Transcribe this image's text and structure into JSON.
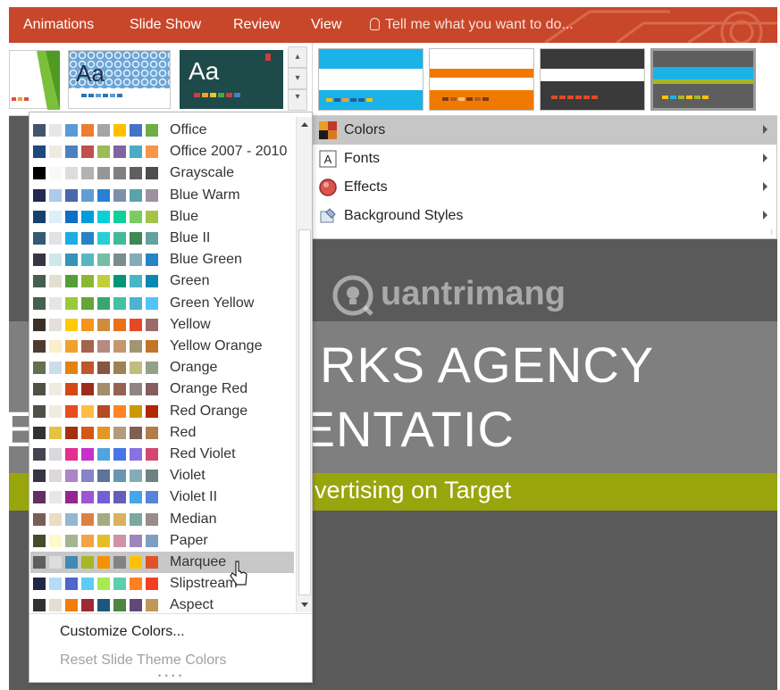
{
  "ribbon": {
    "tabs": [
      "Animations",
      "Slide Show",
      "Review",
      "View"
    ],
    "tell_me": "Tell me what you want to do..."
  },
  "themes": {
    "thumb1_text": "Aa",
    "thumb2_text": "Aa"
  },
  "design_menu": {
    "items": [
      {
        "label": "Colors",
        "icon": "colors-icon",
        "highlighted": true
      },
      {
        "label": "Fonts",
        "icon": "fonts-icon",
        "highlighted": false
      },
      {
        "label": "Effects",
        "icon": "effects-icon",
        "highlighted": false
      },
      {
        "label": "Background Styles",
        "icon": "background-styles-icon",
        "highlighted": false
      }
    ]
  },
  "colors_dropdown": {
    "schemes": [
      {
        "name": "Office",
        "colors": [
          "#44546a",
          "#e7e6e6",
          "#5b9bd5",
          "#ed7d31",
          "#a5a5a5",
          "#ffc000",
          "#4472c4",
          "#70ad47"
        ]
      },
      {
        "name": "Office 2007 - 2010",
        "colors": [
          "#1f497d",
          "#eeece1",
          "#4f81bd",
          "#c0504d",
          "#9bbb59",
          "#8064a2",
          "#4bacc6",
          "#f79646"
        ]
      },
      {
        "name": "Grayscale",
        "colors": [
          "#000000",
          "#f8f8f8",
          "#dddddd",
          "#b2b2b2",
          "#969696",
          "#808080",
          "#5f5f5f",
          "#4d4d4d"
        ]
      },
      {
        "name": "Blue Warm",
        "colors": [
          "#242852",
          "#acccea",
          "#4a66ac",
          "#629dd1",
          "#297fd5",
          "#7f8fa9",
          "#5aa2ae",
          "#9d90a0"
        ]
      },
      {
        "name": "Blue",
        "colors": [
          "#17406d",
          "#dbeff9",
          "#0f6fc6",
          "#009dd9",
          "#0bd0d9",
          "#10cf9b",
          "#7cca62",
          "#a5c249"
        ]
      },
      {
        "name": "Blue II",
        "colors": [
          "#335b74",
          "#dfe3e5",
          "#1cade4",
          "#2683c6",
          "#27ced7",
          "#42ba97",
          "#3e8853",
          "#62a39f"
        ]
      },
      {
        "name": "Blue Green",
        "colors": [
          "#373545",
          "#cee8ea",
          "#3494ba",
          "#58b6c0",
          "#75bda7",
          "#7a8c8e",
          "#84acb6",
          "#2683c6"
        ]
      },
      {
        "name": "Green",
        "colors": [
          "#455f51",
          "#e3ded1",
          "#549e39",
          "#8ab833",
          "#c0cf3a",
          "#029676",
          "#4ab5c4",
          "#0989b1"
        ]
      },
      {
        "name": "Green Yellow",
        "colors": [
          "#455f51",
          "#e7e6e6",
          "#99cb38",
          "#63a537",
          "#37a76f",
          "#44c1a3",
          "#4eb3cf",
          "#51c3f9"
        ]
      },
      {
        "name": "Yellow",
        "colors": [
          "#39302a",
          "#e5dedb",
          "#ffca08",
          "#f8931d",
          "#ce8d3e",
          "#ec7016",
          "#e64823",
          "#9c6a6a"
        ]
      },
      {
        "name": "Yellow Orange",
        "colors": [
          "#4e3b30",
          "#fbeec9",
          "#f0a22e",
          "#a5644e",
          "#b58b80",
          "#c3986d",
          "#a19574",
          "#c17529"
        ]
      },
      {
        "name": "Orange",
        "colors": [
          "#637052",
          "#ccddea",
          "#e48312",
          "#bd582c",
          "#865640",
          "#9b8357",
          "#c2bc80",
          "#94a088"
        ]
      },
      {
        "name": "Orange Red",
        "colors": [
          "#505046",
          "#eeece1",
          "#d34817",
          "#9b2d1f",
          "#a28e6a",
          "#956251",
          "#918485",
          "#855d5d"
        ]
      },
      {
        "name": "Red Orange",
        "colors": [
          "#505046",
          "#eeece1",
          "#e84c22",
          "#ffbd47",
          "#b64926",
          "#ff8427",
          "#cc9900",
          "#b22600"
        ]
      },
      {
        "name": "Red",
        "colors": [
          "#323232",
          "#e5c243",
          "#a5300f",
          "#d55816",
          "#e19825",
          "#b19c7d",
          "#7f5f52",
          "#b27d49"
        ]
      },
      {
        "name": "Red Violet",
        "colors": [
          "#454551",
          "#d8d9dc",
          "#e32d91",
          "#c830cc",
          "#4ea6dc",
          "#4775e7",
          "#8971e1",
          "#d54773"
        ]
      },
      {
        "name": "Violet",
        "colors": [
          "#373545",
          "#dcd8dc",
          "#ad84c6",
          "#8784c7",
          "#5d739a",
          "#6997af",
          "#84acb6",
          "#6f8183"
        ]
      },
      {
        "name": "Violet II",
        "colors": [
          "#632e62",
          "#eae5eb",
          "#92278f",
          "#9b57d3",
          "#755dd9",
          "#665eb8",
          "#45a5ed",
          "#5982db"
        ]
      },
      {
        "name": "Median",
        "colors": [
          "#775f55",
          "#ebddc3",
          "#94b6d2",
          "#dd8047",
          "#a5ab81",
          "#d8b25c",
          "#7ba79d",
          "#968c8c"
        ]
      },
      {
        "name": "Paper",
        "colors": [
          "#444d26",
          "#fefac9",
          "#a5b592",
          "#f3a447",
          "#e7bc29",
          "#d092a7",
          "#9c85c0",
          "#809ec2"
        ]
      },
      {
        "name": "Marquee",
        "colors": [
          "#5e5e5e",
          "#dddddd",
          "#418ab3",
          "#a6b727",
          "#f69200",
          "#838383",
          "#fec306",
          "#df5327"
        ]
      },
      {
        "name": "Slipstream",
        "colors": [
          "#212745",
          "#b4dcfa",
          "#4e67c8",
          "#5eccf3",
          "#a7ea52",
          "#5dceaf",
          "#ff8021",
          "#f14124"
        ]
      },
      {
        "name": "Aspect",
        "colors": [
          "#323232",
          "#e3ded1",
          "#f07f09",
          "#9f2936",
          "#1b587c",
          "#4e8542",
          "#604878",
          "#c19859"
        ]
      }
    ],
    "highlighted_index": 20,
    "customize": "Customize Colors...",
    "reset": "Reset Slide Theme Colors"
  },
  "slide": {
    "title_line1": "RKS AGENCY",
    "title_line2": "E    OYEE ORIENTATIC",
    "subtitle": "vertising on Target",
    "watermark": "uantrimang"
  }
}
